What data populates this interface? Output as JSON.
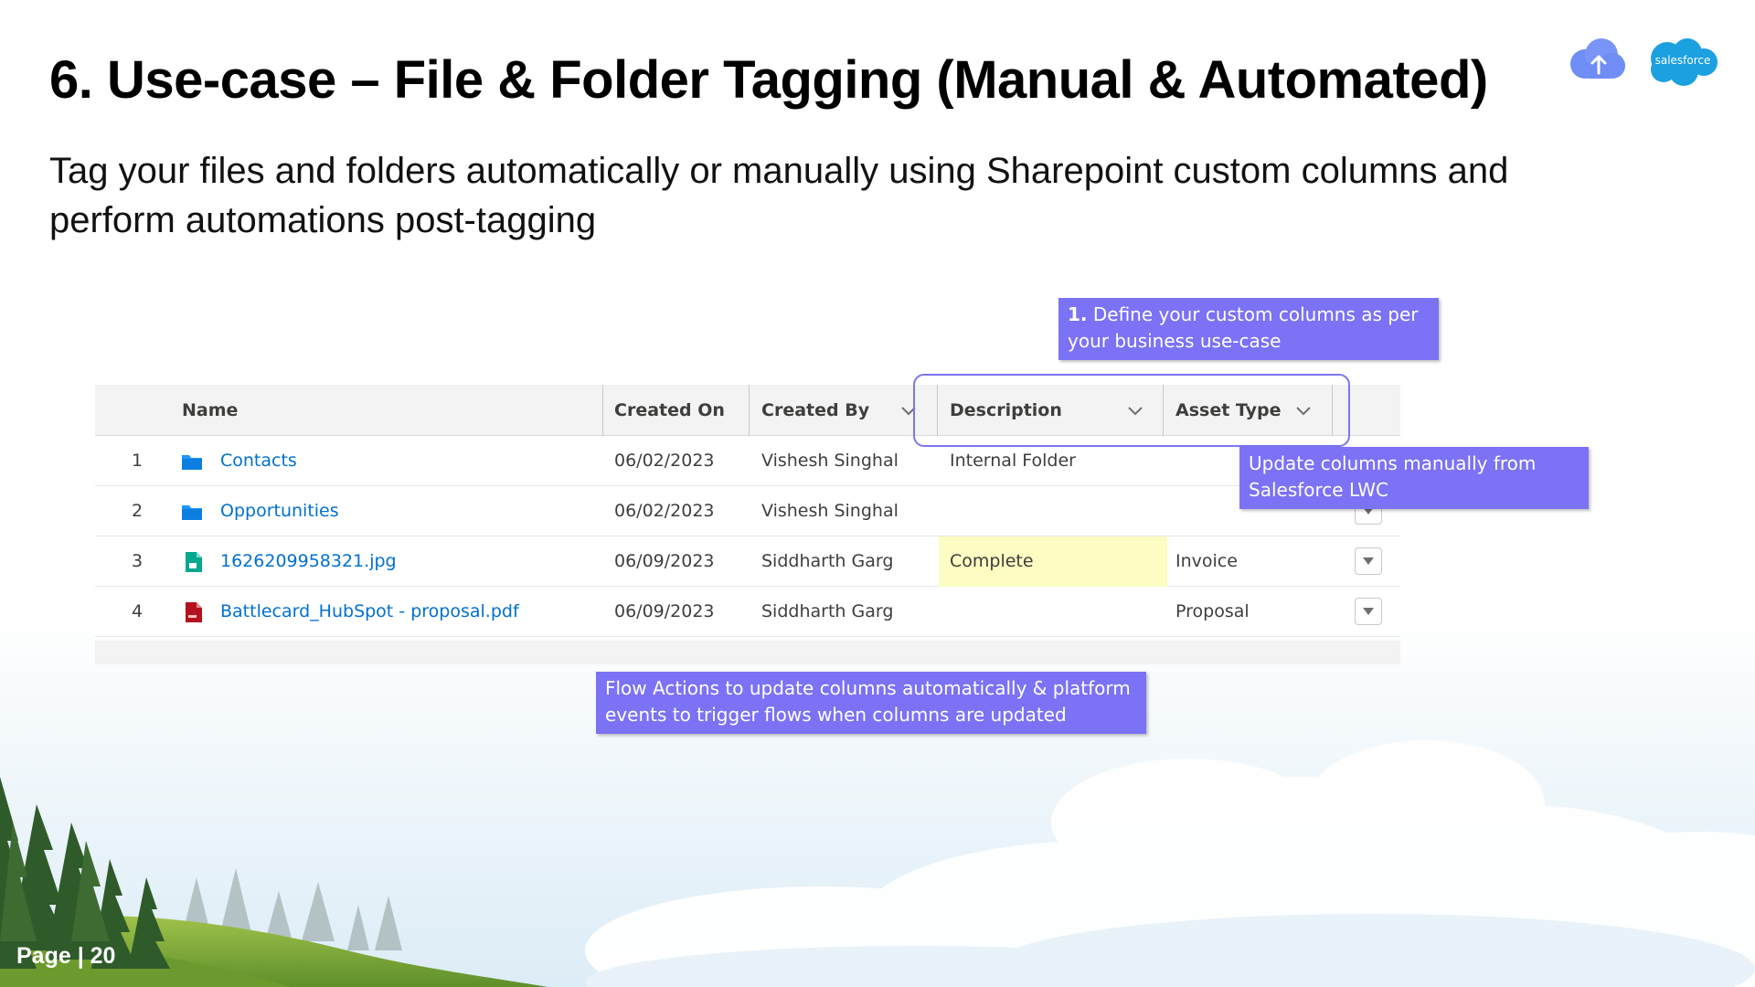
{
  "slide": {
    "title": "6. Use-case – File & Folder Tagging (Manual & Automated)",
    "subtitle": "Tag your files and folders automatically or manually using Sharepoint custom columns and perform automations post-tagging",
    "page_label": "Page | 20"
  },
  "logos": {
    "brand_text": "salesforce"
  },
  "table": {
    "headers": {
      "name": "Name",
      "created_on": "Created On",
      "created_by": "Created By",
      "description": "Description",
      "asset_type": "Asset Type"
    },
    "rows": [
      {
        "num": "1",
        "name": "Contacts",
        "icon": "folder-icon",
        "created_on": "06/02/2023",
        "created_by": "Vishesh Singhal",
        "description": "Internal Folder",
        "asset_type": ""
      },
      {
        "num": "2",
        "name": "Opportunities",
        "icon": "folder-icon",
        "created_on": "06/02/2023",
        "created_by": "Vishesh Singhal",
        "description": "",
        "asset_type": ""
      },
      {
        "num": "3",
        "name": "1626209958321.jpg",
        "icon": "image-file-icon",
        "created_on": "06/09/2023",
        "created_by": "Siddharth Garg",
        "description": "Complete",
        "asset_type": "Invoice"
      },
      {
        "num": "4",
        "name": "Battlecard_HubSpot - proposal.pdf",
        "icon": "pdf-file-icon",
        "created_on": "06/09/2023",
        "created_by": "Siddharth Garg",
        "description": "",
        "asset_type": "Proposal"
      }
    ]
  },
  "callouts": {
    "define": {
      "number": "1.",
      "text": " Define your custom columns as per your business use-case"
    },
    "manual": "Update columns manually from Salesforce LWC",
    "flow": "Flow Actions to update columns automatically & platform events to trigger flows when columns are updated"
  },
  "colors": {
    "callout_bg": "#7b72f5",
    "link": "#0070d2",
    "highlight": "#fdfcc2"
  }
}
